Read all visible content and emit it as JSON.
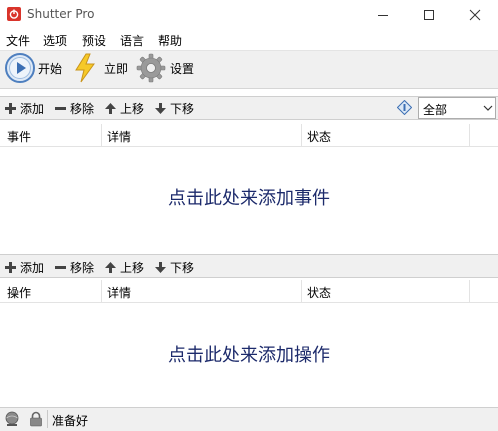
{
  "window": {
    "title": "Shutter Pro"
  },
  "menu": {
    "items": [
      "文件",
      "选项",
      "预设",
      "语言",
      "帮助"
    ]
  },
  "toolbar": {
    "start_label": "开始",
    "now_label": "立即",
    "settings_label": "设置"
  },
  "events": {
    "actions": {
      "add": "添加",
      "remove": "移除",
      "up": "上移",
      "down": "下移"
    },
    "filter_value": "全部",
    "columns": [
      "事件",
      "详情",
      "状态"
    ],
    "placeholder": "点击此处来添加事件"
  },
  "operations": {
    "actions": {
      "add": "添加",
      "remove": "移除",
      "up": "上移",
      "down": "下移"
    },
    "columns": [
      "操作",
      "详情",
      "状态"
    ],
    "placeholder": "点击此处来添加操作"
  },
  "status": {
    "text": "准备好"
  },
  "colors": {
    "placeholder": "#1c2a6b",
    "app_icon": "#d9342b"
  }
}
